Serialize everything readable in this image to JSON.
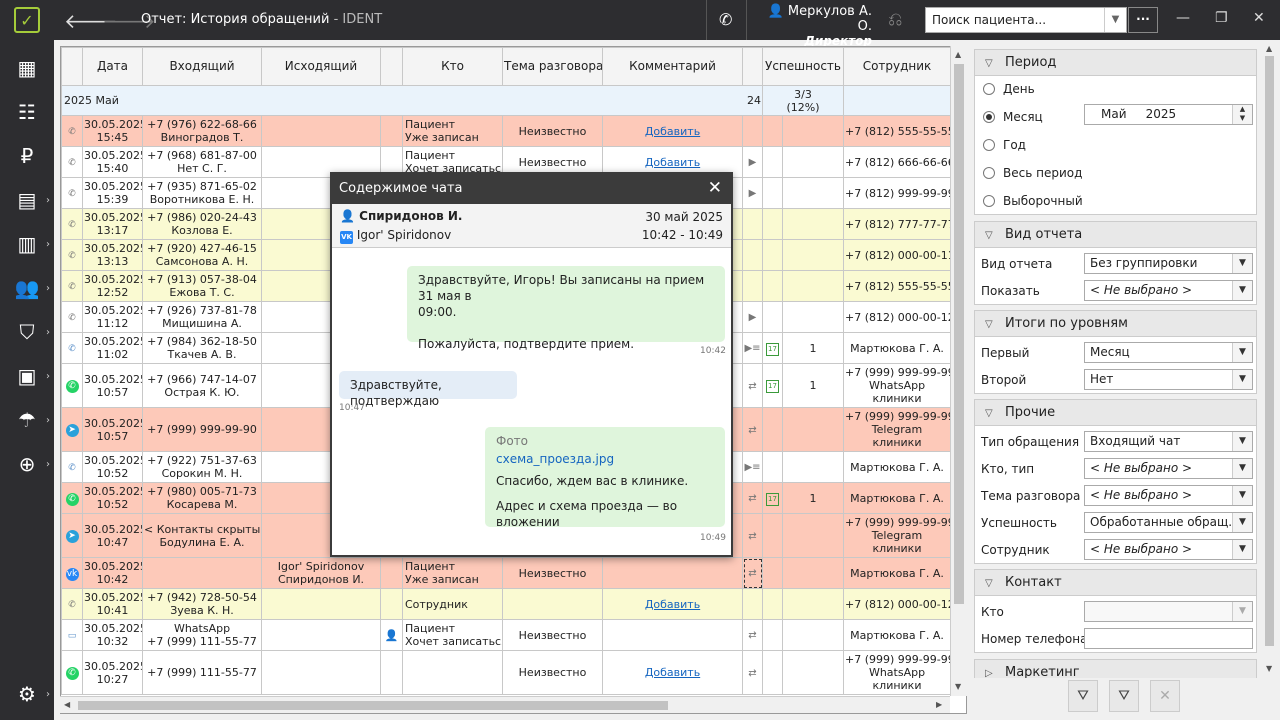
{
  "titlebar": {
    "title": "Отчет: История обращений",
    "app_suffix": " - IDENT",
    "user_name": "Меркулов А. О.",
    "user_role": "Директор",
    "search_placeholder": "Поиск пациента...",
    "more_label": "···"
  },
  "grid": {
    "columns": [
      "Дата",
      "Входящий",
      "Исходящий",
      "Кто",
      "Тема разговора",
      "Комментарий",
      "",
      "Успешность",
      "Сотрудник"
    ],
    "group": {
      "label": "2025 Май",
      "count": "24",
      "success": "3/3",
      "success_pct": "(12%)"
    },
    "rows": [
      {
        "color": "pink",
        "type": "phone",
        "date": "30.05.2025",
        "time": "15:45",
        "in1": "+7 (976) 622-68-66",
        "in2": "Виноградов Т.",
        "out1": "",
        "out2": "",
        "who1": "Пациент",
        "who2": "Уже записан",
        "topic": "Неизвестно",
        "comment": "Добавить",
        "act": "",
        "cal": "",
        "succ": "",
        "emp": "+7 (812) 555-55-55",
        "emp2": "",
        "emp3": ""
      },
      {
        "color": "white",
        "type": "phone",
        "date": "30.05.2025",
        "time": "15:40",
        "in1": "+7 (968) 681-87-00",
        "in2": "Нет С. Г.",
        "out1": "",
        "out2": "",
        "who1": "Пациент",
        "who2": "Хочет записаться",
        "topic": "Неизвестно",
        "comment": "Добавить",
        "act": "▶",
        "cal": "",
        "succ": "",
        "emp": "+7 (812) 666-66-66",
        "emp2": "",
        "emp3": ""
      },
      {
        "color": "white",
        "type": "phone",
        "date": "30.05.2025",
        "time": "15:39",
        "in1": "+7 (935) 871-65-02",
        "in2": "Воротникова Е. Н.",
        "out1": "",
        "out2": "",
        "who1": "",
        "who2": "",
        "topic": "",
        "comment": "",
        "act": "▶",
        "cal": "",
        "succ": "",
        "emp": "+7 (812) 999-99-99",
        "emp2": "",
        "emp3": ""
      },
      {
        "color": "yellow",
        "type": "phone",
        "date": "30.05.2025",
        "time": "13:17",
        "in1": "+7 (986) 020-24-43",
        "in2": "Козлова Е.",
        "out1": "",
        "out2": "",
        "who1": "",
        "who2": "",
        "topic": "",
        "comment": "",
        "act": "",
        "cal": "",
        "succ": "",
        "emp": "+7 (812) 777-77-77",
        "emp2": "",
        "emp3": ""
      },
      {
        "color": "yellow",
        "type": "phone",
        "date": "30.05.2025",
        "time": "13:13",
        "in1": "+7 (920) 427-46-15",
        "in2": "Самсонова А. Н.",
        "out1": "",
        "out2": "",
        "who1": "",
        "who2": "",
        "topic": "",
        "comment": "",
        "act": "",
        "cal": "",
        "succ": "",
        "emp": "+7 (812) 000-00-11",
        "emp2": "",
        "emp3": ""
      },
      {
        "color": "yellow",
        "type": "phone",
        "date": "30.05.2025",
        "time": "12:52",
        "in1": "+7 (913) 057-38-04",
        "in2": "Ежова Т. С.",
        "out1": "",
        "out2": "",
        "who1": "",
        "who2": "",
        "topic": "",
        "comment": "",
        "act": "",
        "cal": "",
        "succ": "",
        "emp": "+7 (812) 555-55-55",
        "emp2": "",
        "emp3": ""
      },
      {
        "color": "white",
        "type": "phone",
        "date": "30.05.2025",
        "time": "11:12",
        "in1": "+7 (926) 737-81-78",
        "in2": "Мищишина А.",
        "out1": "",
        "out2": "",
        "who1": "",
        "who2": "",
        "topic": "",
        "comment": "",
        "act": "▶",
        "cal": "",
        "succ": "",
        "emp": "+7 (812) 000-00-12",
        "emp2": "",
        "emp3": ""
      },
      {
        "color": "white",
        "type": "phone-chat",
        "date": "30.05.2025",
        "time": "11:02",
        "in1": "+7 (984) 362-18-50",
        "in2": "Ткачев А. В.",
        "out1": "",
        "out2": "",
        "who1": "",
        "who2": "",
        "topic": "",
        "comment": "",
        "act": "▶≡",
        "cal": "17",
        "succ": "1",
        "emp": "Мартюкова Г. А.",
        "emp2": "",
        "emp3": ""
      },
      {
        "color": "white",
        "type": "whatsapp",
        "date": "30.05.2025",
        "time": "10:57",
        "in1": "+7 (966) 747-14-07",
        "in2": "Острая К. Ю.",
        "out1": "",
        "out2": "",
        "who1": "",
        "who2": "",
        "topic": "",
        "comment": "",
        "act": "⇄",
        "cal": "17",
        "succ": "1",
        "emp": "+7 (999) 999-99-99",
        "emp2": "WhatsApp",
        "emp3": "клиники"
      },
      {
        "color": "pink",
        "type": "telegram",
        "date": "30.05.2025",
        "time": "10:57",
        "in1": "+7 (999) 999-99-90",
        "in2": "",
        "out1": "",
        "out2": "",
        "who1": "",
        "who2": "",
        "topic": "",
        "comment": "",
        "act": "⇄",
        "cal": "",
        "succ": "",
        "emp": "+7 (999) 999-99-99",
        "emp2": "Telegram",
        "emp3": "клиники"
      },
      {
        "color": "white",
        "type": "phone-in",
        "date": "30.05.2025",
        "time": "10:52",
        "in1": "+7 (922) 751-37-63",
        "in2": "Сорокин М. Н.",
        "out1": "",
        "out2": "",
        "who1": "",
        "who2": "",
        "topic": "",
        "comment": "",
        "act": "▶≡",
        "cal": "",
        "succ": "",
        "emp": "Мартюкова Г. А.",
        "emp2": "",
        "emp3": ""
      },
      {
        "color": "pink",
        "type": "whatsapp",
        "date": "30.05.2025",
        "time": "10:52",
        "in1": "+7 (980) 005-71-73",
        "in2": "Косарева М.",
        "out1": "",
        "out2": "",
        "who1": "",
        "who2": "",
        "topic": "",
        "comment": "",
        "act": "⇄",
        "cal": "17",
        "succ": "1",
        "emp": "Мартюкова Г. А.",
        "emp2": "",
        "emp3": ""
      },
      {
        "color": "pink",
        "type": "telegram",
        "date": "30.05.2025",
        "time": "10:47",
        "in1": "< Контакты скрыты >",
        "in2": "Бодулина Е. А.",
        "out1": "",
        "out2": "",
        "who1": "",
        "who2": "",
        "topic": "",
        "comment": "",
        "act": "⇄",
        "cal": "",
        "succ": "",
        "emp": "+7 (999) 999-99-99",
        "emp2": "Telegram",
        "emp3": "клиники"
      },
      {
        "color": "pink",
        "type": "vk",
        "date": "30.05.2025",
        "time": "10:42",
        "in1": "",
        "in2": "",
        "out1": "Igor' Spiridonov",
        "out2": "Спиридонов И.",
        "who1": "Пациент",
        "who2": "Уже записан",
        "topic": "Неизвестно",
        "comment": "",
        "act": "⇄",
        "cal": "",
        "succ": "",
        "emp": "Мартюкова Г. А.",
        "emp2": "",
        "emp3": ""
      },
      {
        "color": "yellow",
        "type": "phone",
        "date": "30.05.2025",
        "time": "10:41",
        "in1": "+7 (942) 728-50-54",
        "in2": "Зуева К. Н.",
        "out1": "",
        "out2": "",
        "who1": "Сотрудник",
        "who2": "",
        "topic": "",
        "comment": "Добавить",
        "act": "",
        "cal": "",
        "succ": "",
        "emp": "+7 (812) 000-00-12",
        "emp2": "",
        "emp3": ""
      },
      {
        "color": "white",
        "type": "chat",
        "date": "30.05.2025",
        "time": "10:32",
        "in1": "WhatsApp",
        "in2": "+7 (999) 111-55-77",
        "out1": "",
        "out2": "",
        "who1": "Пациент",
        "who2": "Хочет записаться",
        "topic": "Неизвестно",
        "comment": "",
        "act": "⇄",
        "cal": "",
        "succ": "",
        "emp": "Мартюкова Г. А.",
        "emp2": "",
        "emp3": ""
      },
      {
        "color": "white",
        "type": "whatsapp",
        "date": "30.05.2025",
        "time": "10:27",
        "in1": "+7 (999) 111-55-77",
        "in2": "",
        "out1": "",
        "out2": "",
        "who1": "",
        "who2": "",
        "topic": "Неизвестно",
        "comment": "Добавить",
        "act": "⇄",
        "cal": "",
        "succ": "",
        "emp": "+7 (999) 999-99-99",
        "emp2": "WhatsApp",
        "emp3": "клиники"
      }
    ]
  },
  "chat": {
    "title": "Содержимое чата",
    "patient": "Спиридонов И.",
    "account": "Igor' Spiridonov",
    "date": "30 май 2025",
    "time_range": "10:42 - 10:49",
    "m1_line1": "Здравствуйте, Игорь! Вы записаны на прием 31 мая в",
    "m1_line2": "09:00.",
    "m1_line3": "Пожалуйста, подтвердите прием.",
    "m1_time": "10:42",
    "m2_text": "Здравствуйте, подтверждаю",
    "m2_time": "10:47",
    "m3_photo": "Фото",
    "m3_file": "схема_проезда.jpg",
    "m3_line1": "Спасибо, ждем вас в клинике.",
    "m3_line2": "Адрес и схема проезда — во вложении",
    "m3_time": "10:49"
  },
  "filters": {
    "period": {
      "title": "Период",
      "opts": [
        "День",
        "Месяц",
        "Год",
        "Весь период",
        "Выборочный"
      ],
      "month": "Май",
      "year": "2025"
    },
    "report": {
      "title": "Вид отчета",
      "l1": "Вид отчета",
      "v1": "Без группировки",
      "l2": "Показать",
      "v2": "< Не выбрано >"
    },
    "levels": {
      "title": "Итоги по уровням",
      "l1": "Первый",
      "v1": "Месяц",
      "l2": "Второй",
      "v2": "Нет"
    },
    "other": {
      "title": "Прочие",
      "l1": "Тип обращения",
      "v1": "Входящий чат",
      "l2": "Кто, тип",
      "v2": "< Не выбрано >",
      "l3": "Тема разговора",
      "v3": "< Не выбрано >",
      "l4": "Успешность",
      "v4": "Обработанные обращ...",
      "l5": "Сотрудник",
      "v5": "< Не выбрано >"
    },
    "contact": {
      "title": "Контакт",
      "l1": "Кто",
      "l2": "Номер телефона"
    },
    "marketing": {
      "title": "Маркетинг"
    }
  }
}
